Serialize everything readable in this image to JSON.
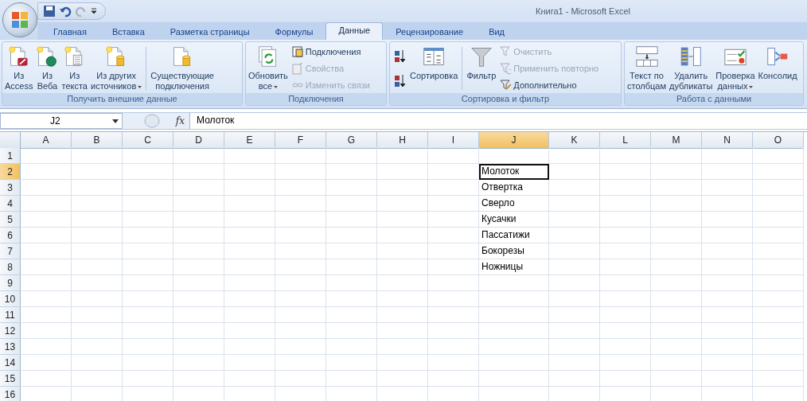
{
  "window": {
    "title": "Книга1  -  Microsoft Excel"
  },
  "tabs": [
    {
      "label": "Главная",
      "selected": false
    },
    {
      "label": "Вставка",
      "selected": false
    },
    {
      "label": "Разметка страницы",
      "selected": false
    },
    {
      "label": "Формулы",
      "selected": false
    },
    {
      "label": "Данные",
      "selected": true
    },
    {
      "label": "Рецензирование",
      "selected": false
    },
    {
      "label": "Вид",
      "selected": false
    }
  ],
  "ribbon": {
    "groups": [
      {
        "title": "Получить внешние данные",
        "items": [
          {
            "kind": "large",
            "lines": [
              "Из",
              "Access"
            ],
            "dropdown": false
          },
          {
            "kind": "large",
            "lines": [
              "Из",
              "Веба"
            ],
            "dropdown": false
          },
          {
            "kind": "large",
            "lines": [
              "Из",
              "текста"
            ],
            "dropdown": false
          },
          {
            "kind": "large",
            "lines": [
              "Из других",
              "источников"
            ],
            "dropdown": true
          },
          {
            "kind": "separator"
          },
          {
            "kind": "large",
            "lines": [
              "Существующие",
              "подключения"
            ],
            "dropdown": false
          }
        ]
      },
      {
        "title": "Подключения",
        "items": [
          {
            "kind": "large",
            "lines": [
              "Обновить",
              "все"
            ],
            "dropdown": true
          },
          {
            "kind": "stack",
            "entries": [
              {
                "label": "Подключения",
                "disabled": false
              },
              {
                "label": "Свойства",
                "disabled": true
              },
              {
                "label": "Изменить связи",
                "disabled": true
              }
            ]
          }
        ]
      },
      {
        "title": "Сортировка и фильтр",
        "items": [
          {
            "kind": "sorters"
          },
          {
            "kind": "large",
            "lines": [
              "Сортировка"
            ],
            "dropdown": false
          },
          {
            "kind": "separator"
          },
          {
            "kind": "large",
            "lines": [
              "Фильтр"
            ],
            "dropdown": false
          },
          {
            "kind": "stack",
            "entries": [
              {
                "label": "Очистить",
                "disabled": true
              },
              {
                "label": "Применить повторно",
                "disabled": true
              },
              {
                "label": "Дополнительно",
                "disabled": false
              }
            ]
          }
        ]
      },
      {
        "title": "Работа с данными",
        "items": [
          {
            "kind": "large",
            "lines": [
              "Текст по",
              "столбцам"
            ],
            "dropdown": false
          },
          {
            "kind": "large",
            "lines": [
              "Удалить",
              "дубликаты"
            ],
            "dropdown": false
          },
          {
            "kind": "large",
            "lines": [
              "Проверка",
              "данных"
            ],
            "dropdown": true
          },
          {
            "kind": "large",
            "lines": [
              "Консолид"
            ],
            "dropdown": false
          }
        ]
      }
    ]
  },
  "formula_bar": {
    "name_box": "J2",
    "function_label": "fx",
    "value": "Молоток"
  },
  "sheet": {
    "columns": [
      {
        "label": "A",
        "selected": false
      },
      {
        "label": "B",
        "selected": false
      },
      {
        "label": "C",
        "selected": false
      },
      {
        "label": "D",
        "selected": false
      },
      {
        "label": "E",
        "selected": false
      },
      {
        "label": "F",
        "selected": false
      },
      {
        "label": "G",
        "selected": false
      },
      {
        "label": "H",
        "selected": false
      },
      {
        "label": "I",
        "selected": false
      },
      {
        "label": "J",
        "selected": true
      },
      {
        "label": "K",
        "selected": false
      },
      {
        "label": "L",
        "selected": false
      },
      {
        "label": "M",
        "selected": false
      },
      {
        "label": "N",
        "selected": false
      },
      {
        "label": "O",
        "selected": false
      }
    ],
    "rows": [
      {
        "label": "1",
        "selected": false
      },
      {
        "label": "2",
        "selected": true,
        "cell_j": {
          "text": "Молоток",
          "active": true
        }
      },
      {
        "label": "3",
        "selected": false,
        "cell_j": {
          "text": "Отвертка",
          "active": false
        }
      },
      {
        "label": "4",
        "selected": false,
        "cell_j": {
          "text": "Сверло",
          "active": false
        }
      },
      {
        "label": "5",
        "selected": false,
        "cell_j": {
          "text": "Кусачки",
          "active": false
        }
      },
      {
        "label": "6",
        "selected": false,
        "cell_j": {
          "text": "Пассатижи",
          "active": false
        }
      },
      {
        "label": "7",
        "selected": false,
        "cell_j": {
          "text": "Бокорезы",
          "active": false
        }
      },
      {
        "label": "8",
        "selected": false,
        "cell_j": {
          "text": "Ножницы",
          "active": false
        }
      },
      {
        "label": "9",
        "selected": false
      },
      {
        "label": "10",
        "selected": false
      },
      {
        "label": "11",
        "selected": false
      },
      {
        "label": "12",
        "selected": false
      },
      {
        "label": "13",
        "selected": false
      },
      {
        "label": "14",
        "selected": false
      },
      {
        "label": "15",
        "selected": false
      },
      {
        "label": "16",
        "selected": false
      }
    ]
  }
}
